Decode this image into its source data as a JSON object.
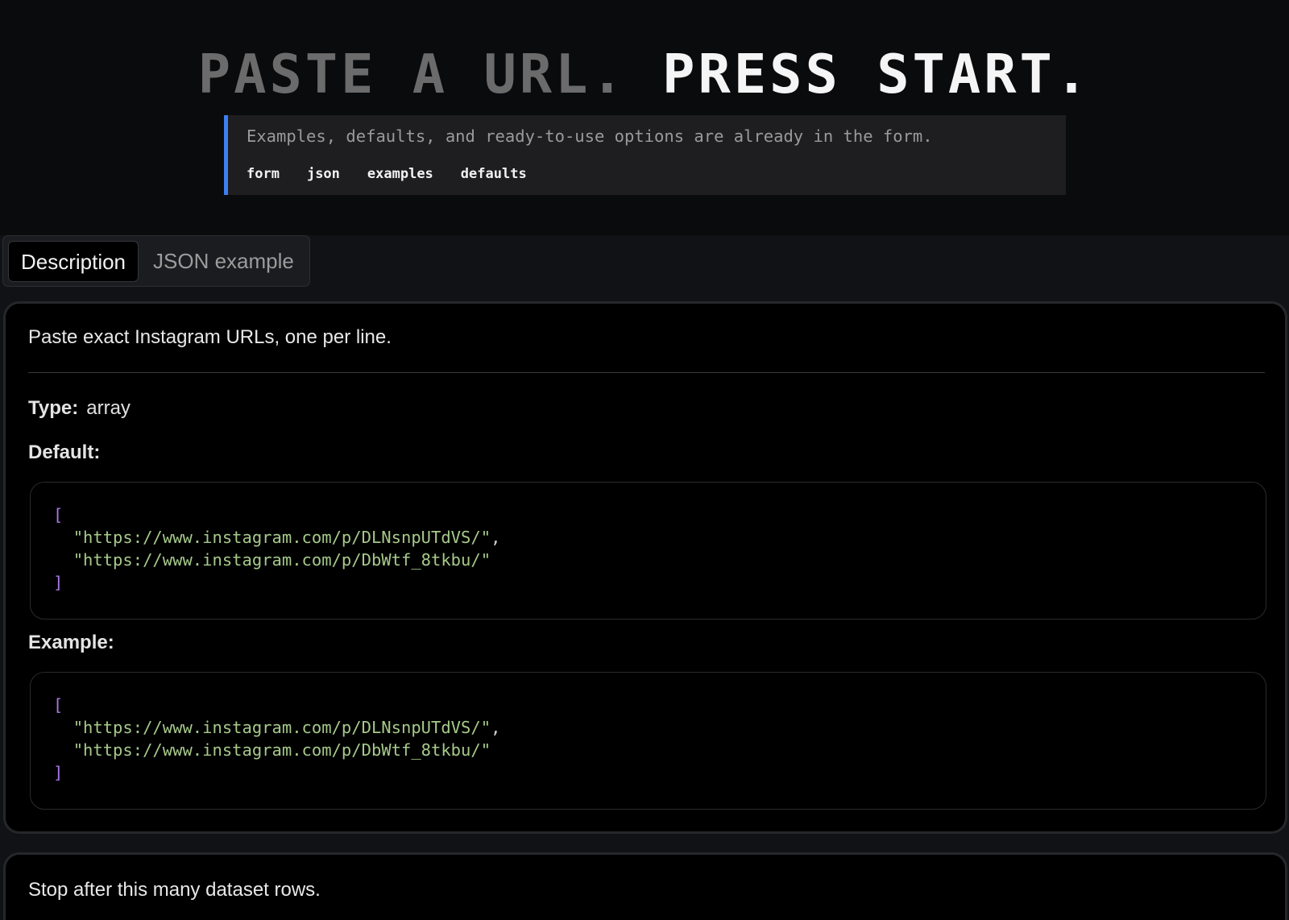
{
  "hero": {
    "title_dim": "PASTE A URL.",
    "title_bright": "PRESS START.",
    "callout_text": "Examples, defaults, and ready-to-use options are already in the form.",
    "tags": [
      "form",
      "json",
      "examples",
      "defaults"
    ],
    "accent_color": "#3d7ef0"
  },
  "tabs": {
    "active": "Description",
    "inactive": "JSON example"
  },
  "field": {
    "description": "Paste exact Instagram URLs, one per line.",
    "type_label": "Type:",
    "type_value": "array",
    "default_label": "Default:",
    "example_label": "Example:",
    "default_code": {
      "open": "[",
      "items": [
        "\"https://www.instagram.com/p/DLNsnpUTdVS/\"",
        "\"https://www.instagram.com/p/DbWtf_8tkbu/\""
      ],
      "close": "]"
    },
    "example_code": {
      "open": "[",
      "items": [
        "\"https://www.instagram.com/p/DLNsnpUTdVS/\"",
        "\"https://www.instagram.com/p/DbWtf_8tkbu/\""
      ],
      "close": "]"
    }
  },
  "next_field": {
    "description": "Stop after this many dataset rows."
  }
}
